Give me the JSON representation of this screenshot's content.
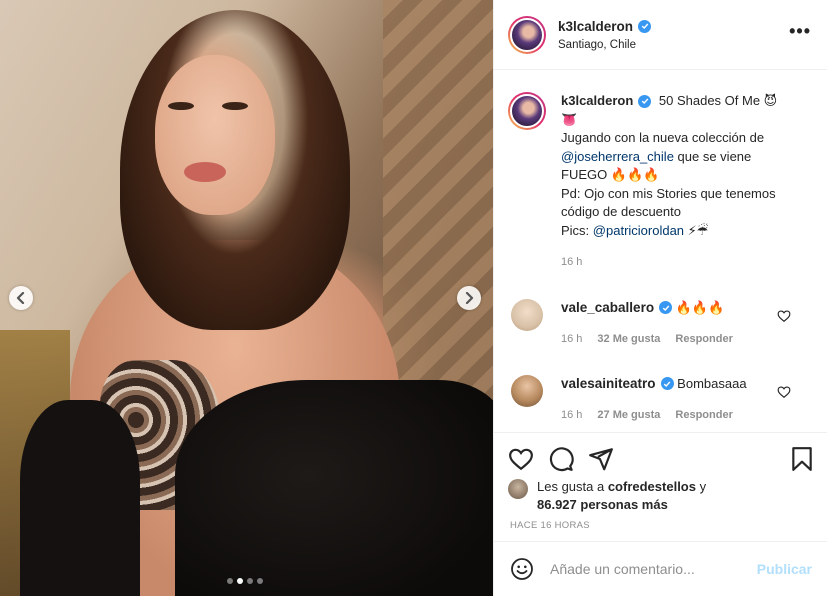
{
  "post": {
    "username": "k3lcalderon",
    "location": "Santiago, Chile",
    "carousel": {
      "count": 4,
      "active_index": 1
    }
  },
  "caption": {
    "username": "k3lcalderon",
    "line1": "50 Shades Of Me 😈",
    "line1b": "👅",
    "line2": "Jugando con la nueva colección de",
    "mention1": "@joseherrera_chile",
    "line3_after": " que se viene",
    "line4": "FUEGO 🔥🔥🔥",
    "line5": "Pd: Ojo con mis Stories que tenemos código de descuento",
    "line6_prefix": "Pics: ",
    "mention2": "@patricioroldan",
    "line6_suffix": " ⚡☔",
    "time": "16 h"
  },
  "comments": [
    {
      "username": "vale_caballero",
      "text": "🔥🔥🔥",
      "time": "16 h",
      "likes": "32 Me gusta",
      "reply": "Responder",
      "avatar_color": "#d8c1a7"
    },
    {
      "username": "valesainiteatro",
      "text": "Bombasaaa",
      "time": "16 h",
      "likes": "27 Me gusta",
      "reply": "Responder",
      "avatar_color": "#b78a5f"
    }
  ],
  "likes": {
    "prefix": "Les gusta a ",
    "user": "cofredestellos",
    "mid": " y",
    "count": "86.927 personas más"
  },
  "timestamp": "HACE 16 HORAS",
  "composer": {
    "placeholder": "Añade un comentario...",
    "post_label": "Publicar"
  },
  "colors": {
    "link": "#00376b",
    "verified": "#3897f0",
    "muted": "#8e8e8e",
    "post_disabled": "#b2dffc"
  },
  "icons": [
    "chevron-left-icon",
    "chevron-right-icon",
    "verified-icon",
    "more-icon",
    "heart-icon",
    "comment-icon",
    "share-icon",
    "bookmark-icon",
    "emoji-icon"
  ]
}
